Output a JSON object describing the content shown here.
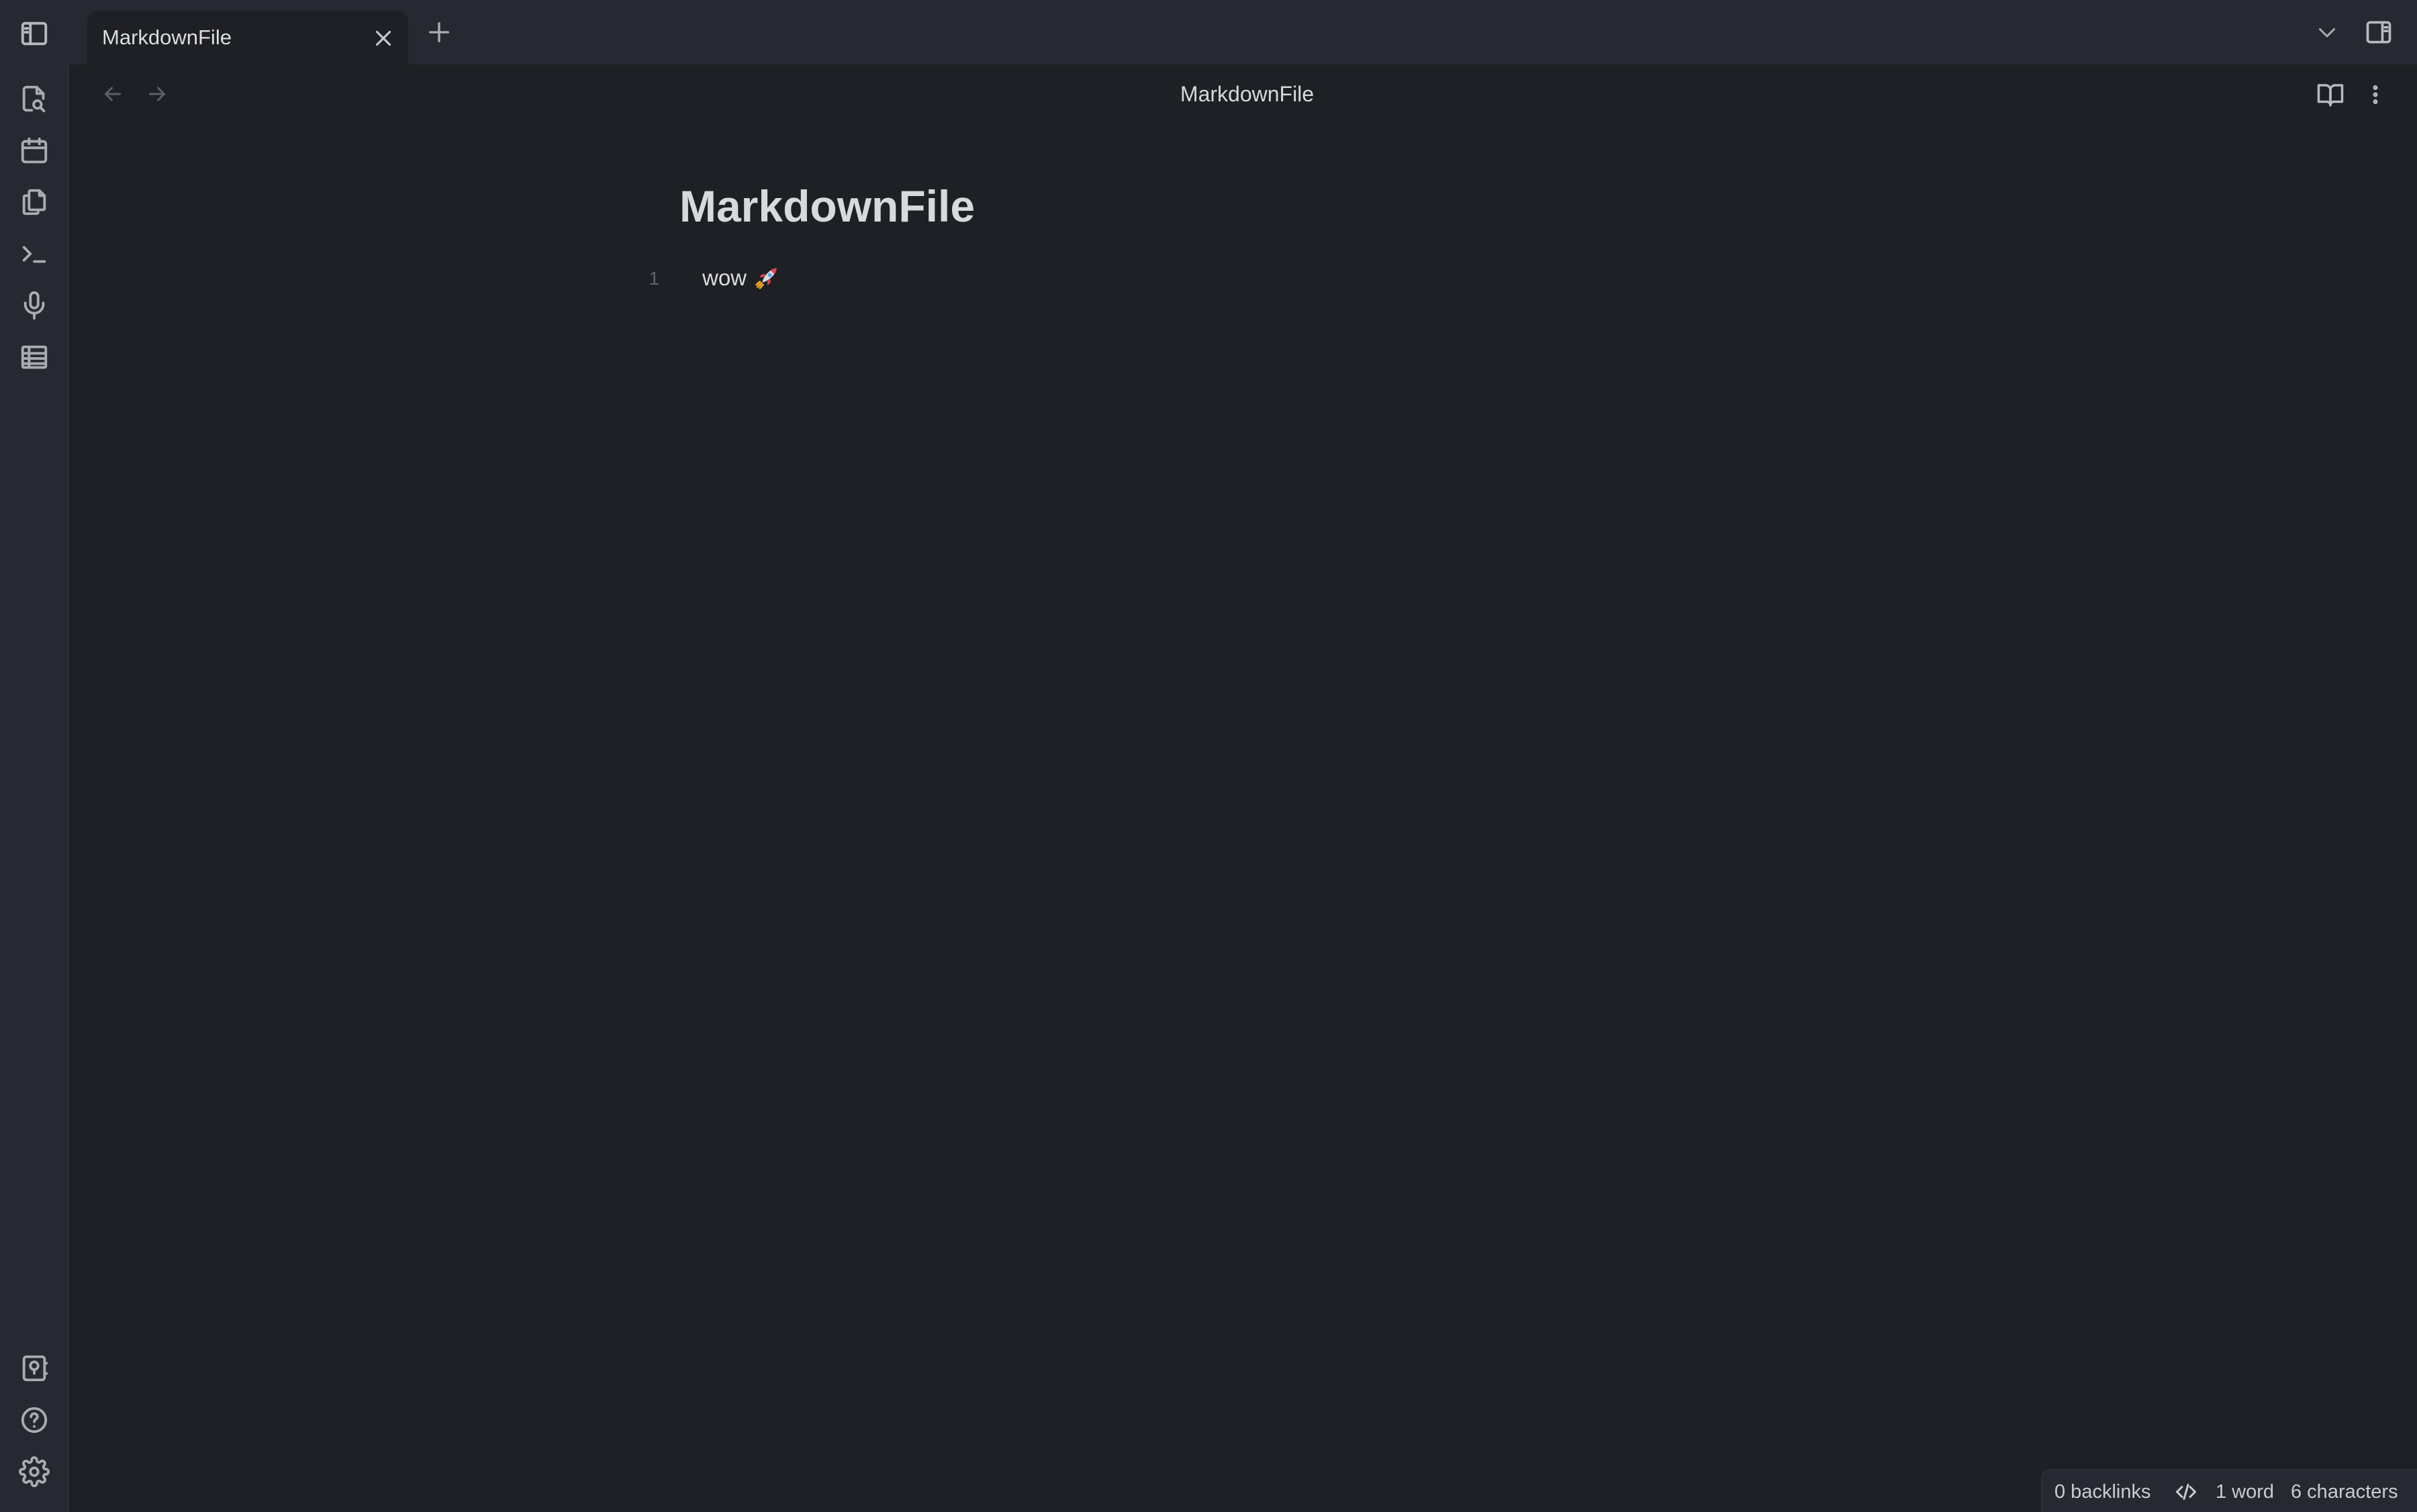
{
  "tabs": [
    {
      "label": "MarkdownFile",
      "active": true
    }
  ],
  "icons": {
    "tabbar_left": "sidebar-left-icon",
    "tab_close": "close-icon",
    "new_tab": "plus-icon",
    "tab_list": "chevron-down-icon",
    "tabbar_right": "sidebar-right-icon",
    "back": "arrow-left-icon",
    "forward": "arrow-right-icon",
    "reading_view": "book-open-icon",
    "more": "more-vertical-icon",
    "status_mode": "code-icon",
    "emoji": "rocket-icon"
  },
  "ribbon": {
    "top": [
      {
        "name": "search-file-icon",
        "label": "Search"
      },
      {
        "name": "calendar-icon",
        "label": "Open today's daily note"
      },
      {
        "name": "copy-icon",
        "label": "Insert template"
      },
      {
        "name": "terminal-icon",
        "label": "Open command palette"
      },
      {
        "name": "microphone-icon",
        "label": "Start recording"
      },
      {
        "name": "table-icon",
        "label": "Create new table"
      }
    ],
    "bottom": [
      {
        "name": "vault-icon",
        "label": "Open another vault"
      },
      {
        "name": "help-icon",
        "label": "Help"
      },
      {
        "name": "settings-icon",
        "label": "Settings"
      }
    ]
  },
  "view_header": {
    "title": "MarkdownFile"
  },
  "editor": {
    "title": "MarkdownFile",
    "lines": [
      {
        "number": "1",
        "text": "wow"
      }
    ]
  },
  "status_bar": {
    "backlinks": "0 backlinks",
    "words": "1 word",
    "characters": "6 characters"
  },
  "colors": {
    "background": "#1e2025",
    "chrome": "#262931",
    "text": "#dcdde1",
    "muted": "#a9acb3",
    "line_number": "#5f636b"
  }
}
